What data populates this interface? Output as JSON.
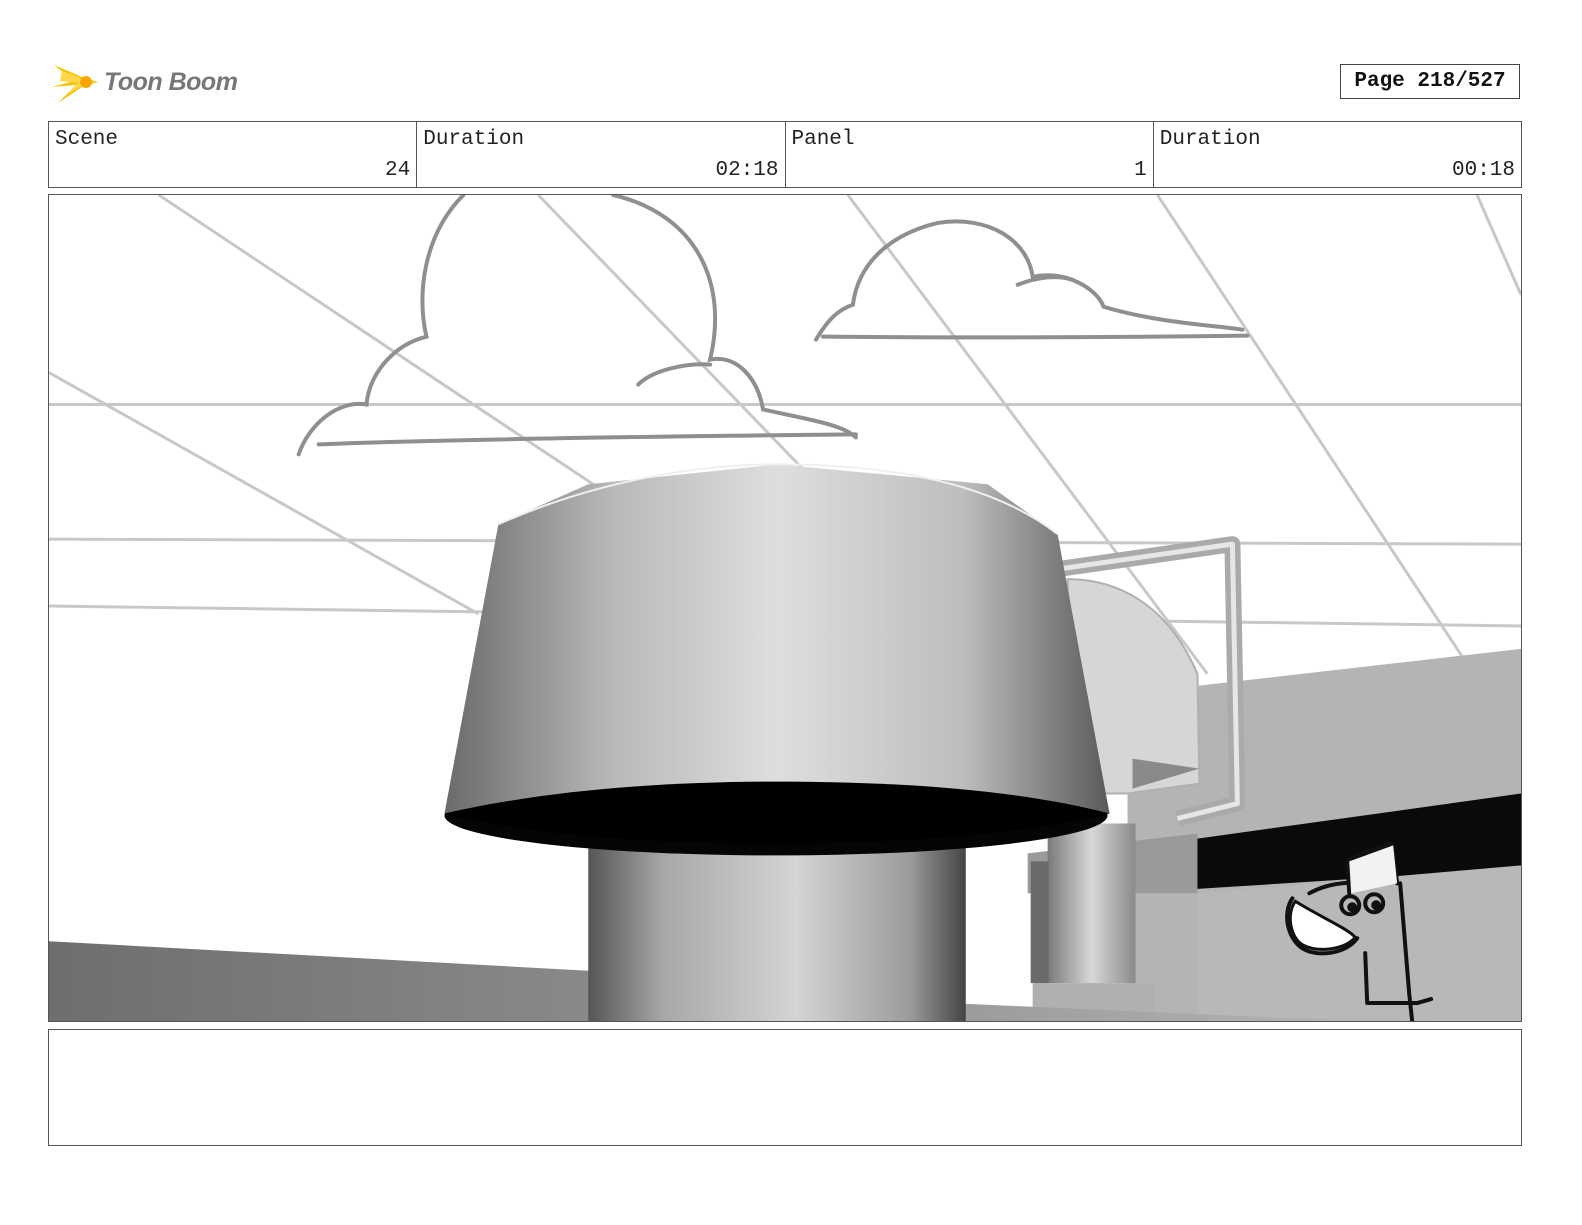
{
  "header": {
    "logo_text": "Toon Boom",
    "page_label": "Page 218/527"
  },
  "info": {
    "scene_label": "Scene",
    "scene_value": "24",
    "scene_duration_label": "Duration",
    "scene_duration_value": "02:18",
    "panel_label": "Panel",
    "panel_value": "1",
    "panel_duration_label": "Duration",
    "panel_duration_value": "00:18"
  },
  "panel": {
    "description": ""
  },
  "colors": {
    "logo_yellow": "#f5c400",
    "logo_text": "#777777",
    "border": "#555555"
  }
}
